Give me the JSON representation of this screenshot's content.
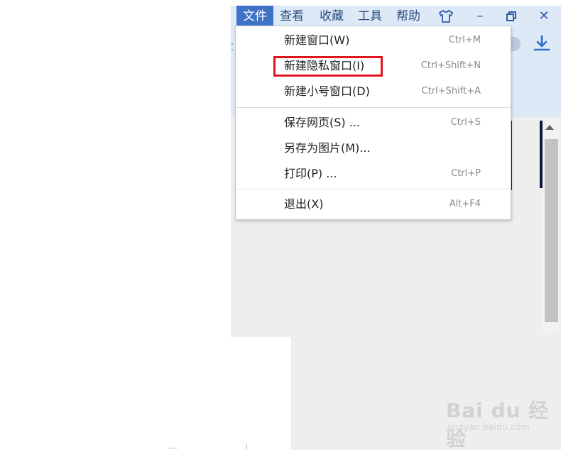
{
  "menubar": {
    "items": [
      {
        "label": "文件",
        "active": true
      },
      {
        "label": "查看"
      },
      {
        "label": "收藏"
      },
      {
        "label": "工具"
      },
      {
        "label": "帮助"
      }
    ]
  },
  "window_controls": {
    "skin": "skin-shirt-icon",
    "minimize": "–",
    "restore": "restore-icon",
    "close": "✕"
  },
  "toolbar": {
    "download_icon": "download-icon"
  },
  "file_menu": {
    "items": [
      {
        "label": "新建窗口(W)",
        "shortcut": "Ctrl+M"
      },
      {
        "label": "新建隐私窗口(I)",
        "shortcut": "Ctrl+Shift+N",
        "highlighted": true
      },
      {
        "label": "新建小号窗口(D)",
        "shortcut": "Ctrl+Shift+A"
      },
      {
        "label": "保存网页(S) ...",
        "shortcut": "Ctrl+S"
      },
      {
        "label": "另存为图片(M)...",
        "shortcut": ""
      },
      {
        "label": "打印(P) ...",
        "shortcut": "Ctrl+P"
      },
      {
        "label": "退出(X)",
        "shortcut": "Alt+F4"
      }
    ]
  },
  "watermark": {
    "logo": "Bai du 经验",
    "url": "jingyan.baidu.com"
  },
  "colors": {
    "accent": "#3f73c6",
    "highlight_box": "#e0141e",
    "menubar_bg": "#dde9f7"
  }
}
